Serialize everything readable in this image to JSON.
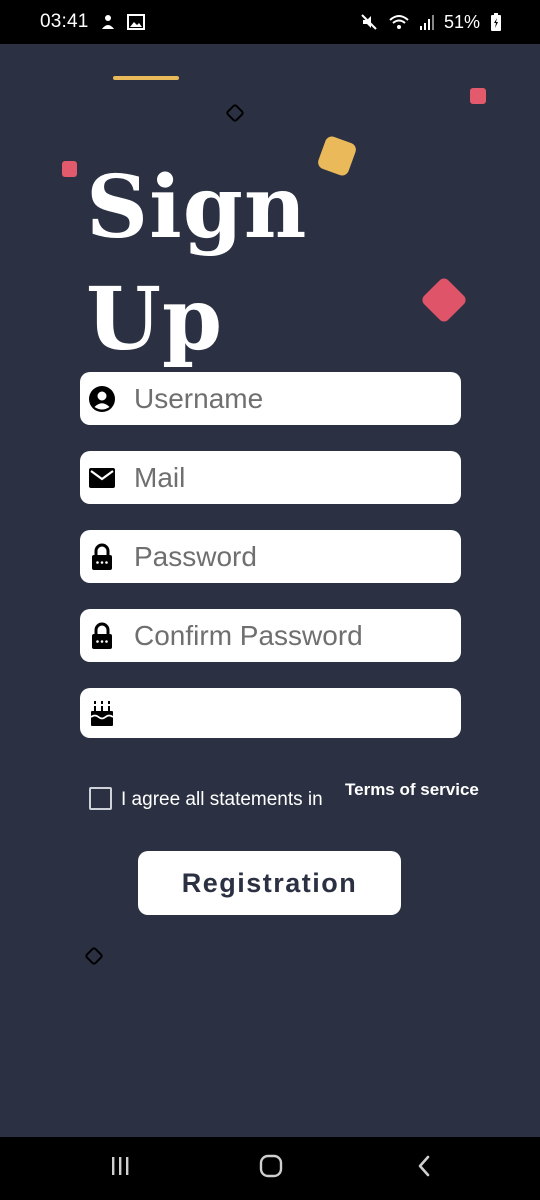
{
  "status_bar": {
    "time": "03:41",
    "battery_percent": "51%",
    "icons": [
      "notification-icon",
      "gallery-icon",
      "mute-icon",
      "wifi-icon",
      "signal-icon",
      "battery-icon"
    ]
  },
  "title": "Sign Up",
  "form": {
    "username_placeholder": "Username",
    "mail_placeholder": "Mail",
    "password_placeholder": "Password",
    "confirm_password_placeholder": "Confirm Password",
    "birthdate_placeholder": ""
  },
  "terms": {
    "checked": false,
    "agree_text": "I agree all statements in",
    "link_text": "Terms of service"
  },
  "register_button_label": "Registration",
  "colors": {
    "background": "#2b3142",
    "accent_gold": "#e9b95a",
    "accent_red": "#df5468"
  },
  "nav_bar": {
    "icons": [
      "recent-apps-icon",
      "home-icon",
      "back-icon"
    ]
  }
}
